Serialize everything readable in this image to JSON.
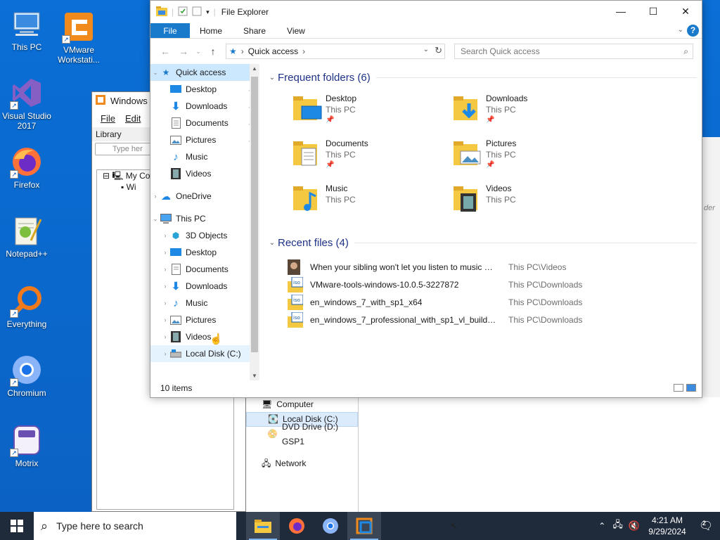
{
  "desktop_icons": [
    {
      "label": "This PC",
      "icon": "this-pc-icon"
    },
    {
      "label": "VMware Workstati...",
      "icon": "vmware-icon"
    },
    {
      "label": "Visual Studio 2017",
      "icon": "visual-studio-icon"
    },
    {
      "label": "Firefox",
      "icon": "firefox-icon"
    },
    {
      "label": "Notepad++",
      "icon": "notepad-plus-plus-icon"
    },
    {
      "label": "Everything",
      "icon": "everything-icon"
    },
    {
      "label": "Chromium",
      "icon": "chromium-icon"
    },
    {
      "label": "Motrix",
      "icon": "motrix-icon"
    }
  ],
  "background_window": {
    "title": "Windows",
    "menu": [
      "File",
      "Edit"
    ],
    "library_label": "Library",
    "search_placeholder": "Type her",
    "tree": [
      "My Co",
      "Wi"
    ],
    "nav": [
      "Computer",
      "Local Disk (C:)",
      "DVD Drive (D:) GSP1",
      "Network"
    ],
    "right_fragment": "der"
  },
  "explorer": {
    "title": "File Explorer",
    "ribbon_tabs": [
      "File",
      "Home",
      "Share",
      "View"
    ],
    "help": "?",
    "address": "Quick access",
    "search_placeholder": "Search Quick access",
    "nav": {
      "quick_access": "Quick access",
      "pinned": [
        "Desktop",
        "Downloads",
        "Documents",
        "Pictures"
      ],
      "unpinned": [
        "Music",
        "Videos"
      ],
      "onedrive": "OneDrive",
      "this_pc": "This PC",
      "this_pc_items": [
        "3D Objects",
        "Desktop",
        "Documents",
        "Downloads",
        "Music",
        "Pictures",
        "Videos",
        "Local Disk (C:)"
      ]
    },
    "frequent_header": "Frequent folders (6)",
    "frequent": [
      {
        "name": "Desktop",
        "location": "This PC",
        "pinned": true
      },
      {
        "name": "Downloads",
        "location": "This PC",
        "pinned": true
      },
      {
        "name": "Documents",
        "location": "This PC",
        "pinned": true
      },
      {
        "name": "Pictures",
        "location": "This PC",
        "pinned": true
      },
      {
        "name": "Music",
        "location": "This PC",
        "pinned": false
      },
      {
        "name": "Videos",
        "location": "This PC",
        "pinned": false
      }
    ],
    "recent_header": "Recent files (4)",
    "recent": [
      {
        "name": "When your sibling won't let you listen to music 😂...",
        "path": "This PC\\Videos"
      },
      {
        "name": "VMware-tools-windows-10.0.5-3227872",
        "path": "This PC\\Downloads"
      },
      {
        "name": "en_windows_7_with_sp1_x64",
        "path": "This PC\\Downloads"
      },
      {
        "name": "en_windows_7_professional_with_sp1_vl_build_x6...",
        "path": "This PC\\Downloads"
      }
    ],
    "status": "10 items"
  },
  "taskbar": {
    "search_placeholder": "Type here to search",
    "time": "4:21 AM",
    "date": "9/29/2024",
    "notifications": "2"
  },
  "colors": {
    "accent": "#1979ca",
    "desktop": "#0a6fd6",
    "taskbar": "#1f2a3a",
    "folder": "#f5c842"
  }
}
